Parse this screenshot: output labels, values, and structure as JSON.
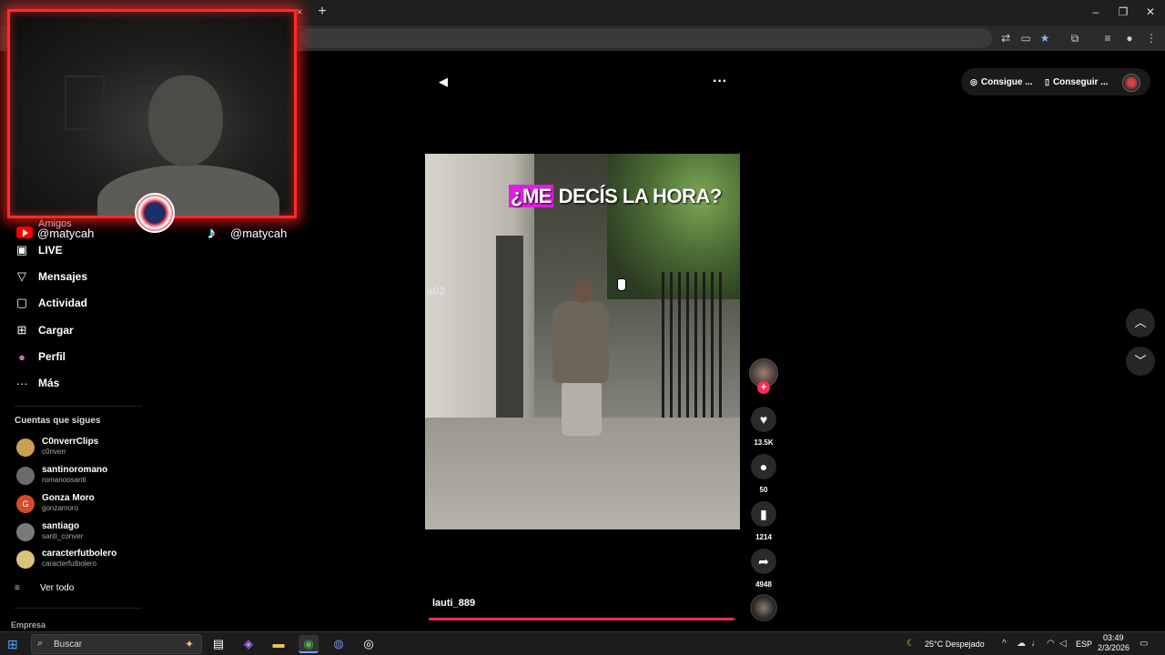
{
  "browser": {
    "tab_close": "×",
    "new_tab": "+",
    "window_controls": [
      "–",
      "❐",
      "✕"
    ],
    "toolbar_icons": [
      "translate-icon",
      "cast-icon",
      "star-icon",
      "extensions-icon",
      "media-icon",
      "profile-icon",
      "menu-icon"
    ]
  },
  "overlay": {
    "youtube_handle": "@matycah",
    "tiktok_handle": "@matycah"
  },
  "sidebar": {
    "amigos": "Amigos",
    "items": [
      {
        "label": "LIVE",
        "icon": "live-icon"
      },
      {
        "label": "Mensajes",
        "icon": "message-icon"
      },
      {
        "label": "Actividad",
        "icon": "activity-icon"
      },
      {
        "label": "Cargar",
        "icon": "upload-icon"
      },
      {
        "label": "Perfil",
        "icon": "profile-icon"
      },
      {
        "label": "Más",
        "icon": "more-icon"
      }
    ],
    "following_title": "Cuentas que sigues",
    "following": [
      {
        "name": "C0nverrClips",
        "handle": "c0nverr",
        "color": "#c8a050"
      },
      {
        "name": "santinoromano",
        "handle": "romanoosanti",
        "color": "#6b6b6b"
      },
      {
        "name": "Gonza Moro",
        "handle": "gonzamoro",
        "color": "#d64b2b",
        "initial": "G"
      },
      {
        "name": "santiago",
        "handle": "santi_conver",
        "color": "#7a7a7a"
      },
      {
        "name": "caracterfutbolero",
        "handle": "caracterfutbolero",
        "color": "#d9c27a"
      }
    ],
    "see_all": "Ver todo",
    "footer": "Empresa"
  },
  "video": {
    "caption_highlight": "¿ME",
    "caption_rest": " DECÍS LA HORA?",
    "watermark": "a02",
    "username": "lauti_889",
    "progress": 0.99
  },
  "actions": {
    "follow_plus": "+",
    "likes": "13.5K",
    "comments": "50",
    "saves": "1214",
    "shares": "4948"
  },
  "topbar": {
    "get_coins": "Consigue ...",
    "get_app": "Conseguir ..."
  },
  "taskbar": {
    "search_placeholder": "Buscar",
    "weather": "25°C  Despejado",
    "lang": "ESP",
    "time": "03:49",
    "date": "2/3/2026"
  },
  "colors": {
    "accent": "#fe2c55",
    "cam_border": "#ff2b2b",
    "caption_highlight": "#e01ee0"
  }
}
